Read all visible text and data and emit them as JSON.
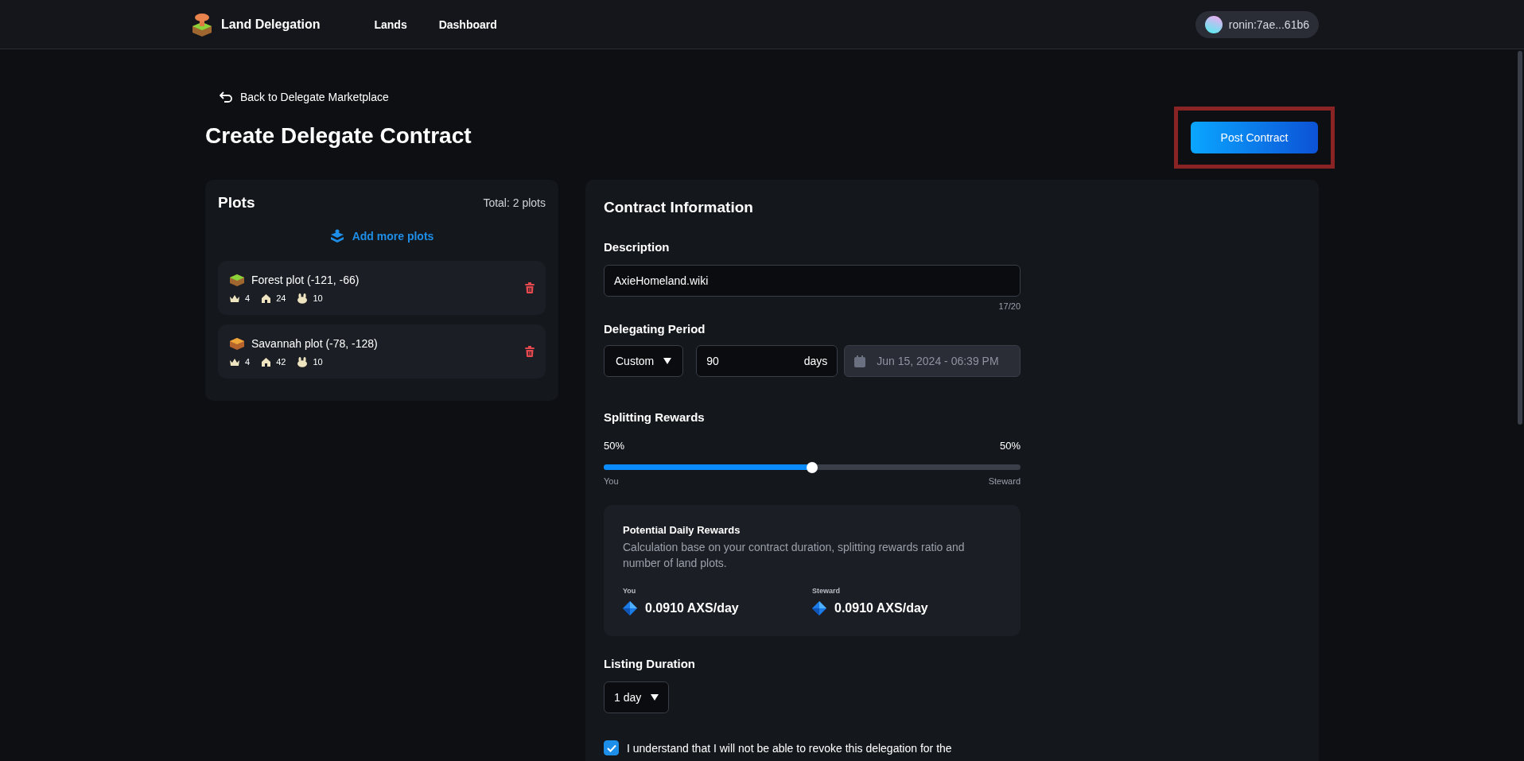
{
  "header": {
    "brand": "Land Delegation",
    "nav": [
      "Lands",
      "Dashboard"
    ],
    "wallet": "ronin:7ae...61b6"
  },
  "back_link": "Back to Delegate Marketplace",
  "title": "Create Delegate Contract",
  "post_button": {
    "label": "Post Contract",
    "highlighted": true
  },
  "plots_panel": {
    "title": "Plots",
    "total": "Total: 2 plots",
    "add_link": "Add more plots",
    "plots": [
      {
        "kind": "forest",
        "name": "Forest plot (-121, -66)",
        "stats": [
          "4",
          "24",
          "10"
        ]
      },
      {
        "kind": "savannah",
        "name": "Savannah plot (-78, -128)",
        "stats": [
          "4",
          "42",
          "10"
        ]
      }
    ]
  },
  "contract": {
    "title": "Contract Information",
    "description": {
      "label": "Description",
      "value": "AxieHomeland.wiki",
      "counter": "17/20"
    },
    "period": {
      "label": "Delegating Period",
      "mode": "Custom",
      "days": "90",
      "unit": "days",
      "end_date": "Jun 15, 2024 - 06:39 PM"
    },
    "split": {
      "label": "Splitting Rewards",
      "left_pct": "50%",
      "right_pct": "50%",
      "level": 0.5,
      "left_label": "You",
      "right_label": "Steward"
    },
    "rewards": {
      "title": "Potential Daily Rewards",
      "note": "Calculation base on your contract duration, splitting rewards ratio and number of land plots.",
      "items": [
        {
          "label": "You",
          "value": "0.0910 AXS/day"
        },
        {
          "label": "Steward",
          "value": "0.0910 AXS/day"
        }
      ]
    },
    "listing": {
      "label": "Listing Duration",
      "value": "1 day"
    },
    "agreement": {
      "checked": true,
      "text": "I understand that I will not be able to revoke this delegation for the"
    }
  }
}
